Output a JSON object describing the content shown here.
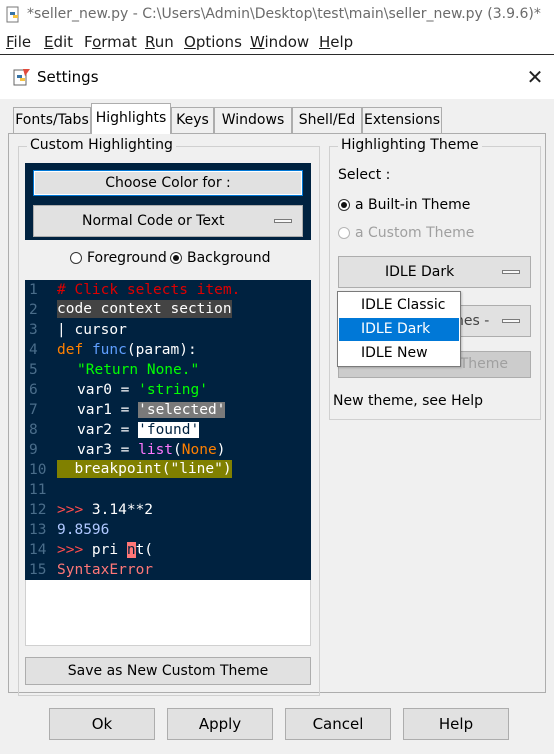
{
  "window": {
    "title": "*seller_new.py - C:\\Users\\Admin\\Desktop\\test\\main\\seller_new.py (3.9.6)*"
  },
  "menubar": {
    "items": [
      {
        "label": "File",
        "u": "F",
        "rest": "ile"
      },
      {
        "label": "Edit",
        "u": "E",
        "rest": "dit"
      },
      {
        "label": "Format",
        "u": "",
        "pre": "F",
        "u2": "o",
        "rest": "rmat"
      },
      {
        "label": "Run",
        "u": "R",
        "rest": "un"
      },
      {
        "label": "Options",
        "u": "O",
        "rest": "ptions"
      },
      {
        "label": "Window",
        "u": "W",
        "rest": "indow"
      },
      {
        "label": "Help",
        "u": "H",
        "rest": "elp"
      }
    ]
  },
  "dialog": {
    "title": "Settings",
    "close_glyph": "✕",
    "tabs": [
      "Fonts/Tabs",
      "Highlights",
      "Keys",
      "Windows",
      "Shell/Ed",
      "Extensions"
    ],
    "active_tab": "Highlights"
  },
  "custom_highlighting": {
    "group_label": "Custom Highlighting",
    "choose_color_label": "Choose Color for :",
    "element_combo_value": "Normal Code or Text",
    "foreground_label": "Foreground",
    "background_label": "Background",
    "selected_radio": "Background",
    "save_button": "Save as New Custom Theme"
  },
  "code_preview": {
    "line_numbers": [
      "1",
      "2",
      "3",
      "4",
      "5",
      "6",
      "7",
      "8",
      "9",
      "10",
      "11",
      "12",
      "13",
      "14",
      "15"
    ],
    "lines": {
      "l1": "# Click selects item.",
      "l2": "code context section",
      "l3": "| cursor",
      "l4_def": "def",
      "l4_func": "func",
      "l4_rest": "(param):",
      "l5": "\"Return None.\"",
      "l6_a": "var0 = ",
      "l6_b": "'string'",
      "l7_a": "var1 = ",
      "l7_b": "'selected'",
      "l8_a": "var2 = ",
      "l8_b": "'found'",
      "l9_a": "var3 = ",
      "l9_b": "list",
      "l9_c": "(",
      "l9_d": "None",
      "l9_e": ")",
      "l10": "  breakpoint(\"line\")",
      "l12_a": ">>> ",
      "l12_b": "3.14**2",
      "l13": "9.8596",
      "l14_a": ">>> ",
      "l14_b": "pri ",
      "l14_c": "n",
      "l14_d": "t(",
      "l15": "SyntaxError"
    }
  },
  "highlighting_theme": {
    "group_label": "Highlighting Theme",
    "select_label": "Select :",
    "builtin_label": "a Built-in Theme",
    "custom_label": "a Custom Theme",
    "builtin_combo_value": "IDLE Dark",
    "custom_combo_partial": "hes -",
    "delete_button_partial": "Theme",
    "note": "New theme, see Help",
    "dropdown_options": [
      "IDLE Classic",
      "IDLE Dark",
      "IDLE New"
    ],
    "dropdown_selected": "IDLE Dark"
  },
  "footer": {
    "ok": "Ok",
    "apply": "Apply",
    "cancel": "Cancel",
    "help": "Help"
  },
  "colors": {
    "code_bg": "#002240",
    "comment": "#dd0000",
    "keyword": "#ff8000",
    "builtin": "#ff77ff",
    "string": "#02ff02",
    "selected_bg": "#7a7a7a",
    "found_bg": "#ffffff",
    "breakpoint_bg": "#808000",
    "prompt": "#ff4d4d",
    "stdout": "#b0c8ff",
    "error_bg": "#ff7777",
    "accent": "#0078d7"
  }
}
